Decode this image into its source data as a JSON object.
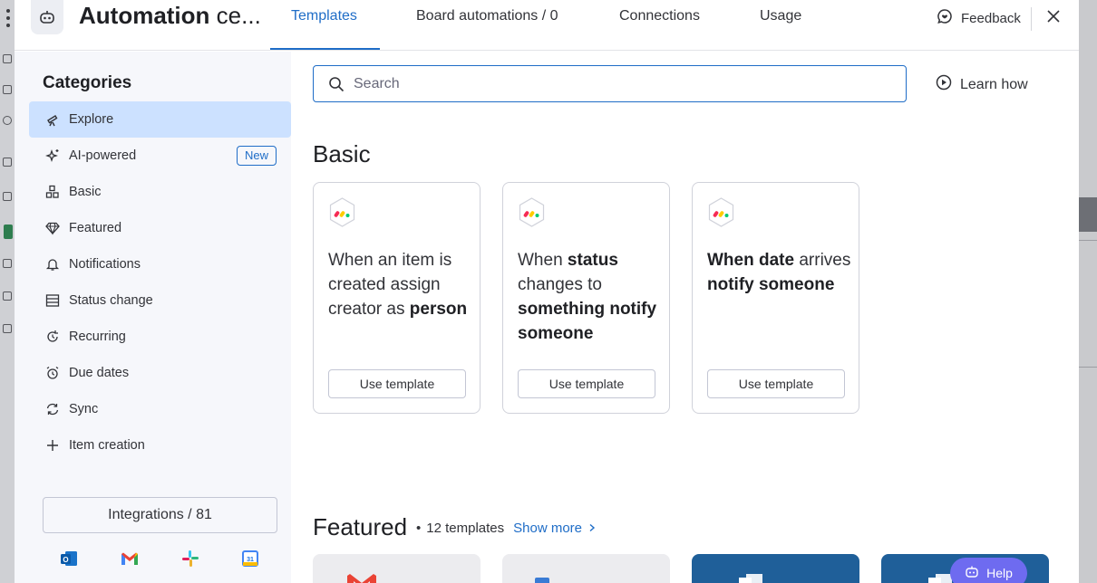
{
  "header": {
    "title_bold": "Automation",
    "title_rest": "ce...",
    "tabs": [
      {
        "label": "Templates",
        "active": true
      },
      {
        "label": "Board automations / 0",
        "active": false
      },
      {
        "label": "Connections",
        "active": false
      },
      {
        "label": "Usage",
        "active": false
      }
    ],
    "feedback_label": "Feedback",
    "app_icon": "robot-icon",
    "close_icon": "close-icon"
  },
  "sidebar": {
    "title": "Categories",
    "items": [
      {
        "label": "Explore",
        "icon": "telescope-icon",
        "active": true
      },
      {
        "label": "AI-powered",
        "icon": "sparkle-icon",
        "badge": "New"
      },
      {
        "label": "Basic",
        "icon": "shapes-icon"
      },
      {
        "label": "Featured",
        "icon": "diamond-icon"
      },
      {
        "label": "Notifications",
        "icon": "bell-icon"
      },
      {
        "label": "Status change",
        "icon": "status-list-icon"
      },
      {
        "label": "Recurring",
        "icon": "recurring-icon"
      },
      {
        "label": "Due dates",
        "icon": "alarm-clock-icon"
      },
      {
        "label": "Sync",
        "icon": "sync-icon"
      },
      {
        "label": "Item creation",
        "icon": "plus-icon"
      }
    ],
    "integrations_label": "Integrations / 81",
    "integration_icons": [
      "outlook-icon",
      "gmail-icon",
      "slack-icon",
      "google-calendar-icon"
    ]
  },
  "search": {
    "placeholder": "Search",
    "value": ""
  },
  "learn_how_label": "Learn how",
  "basic": {
    "title": "Basic",
    "cards": [
      {
        "parts": [
          {
            "t": "When an item is created assign creator as ",
            "b": false
          },
          {
            "t": "person",
            "b": true
          }
        ],
        "button": "Use template"
      },
      {
        "parts": [
          {
            "t": "When ",
            "b": false
          },
          {
            "t": "status",
            "b": true
          },
          {
            "t": " changes to ",
            "b": false
          },
          {
            "t": "something notify someone",
            "b": true
          }
        ],
        "button": "Use template"
      },
      {
        "parts": [
          {
            "t": "When date",
            "b": true
          },
          {
            "t": " arrives ",
            "b": false
          },
          {
            "t": "notify someone",
            "b": true
          }
        ],
        "button": "Use template"
      }
    ]
  },
  "featured": {
    "title": "Featured",
    "count": "12 templates",
    "show_more": "Show more"
  },
  "help_label": "Help",
  "colors": {
    "accent": "#1f6dc7",
    "active_bg": "#cce1ff",
    "help_bg": "#6e6bf0"
  }
}
